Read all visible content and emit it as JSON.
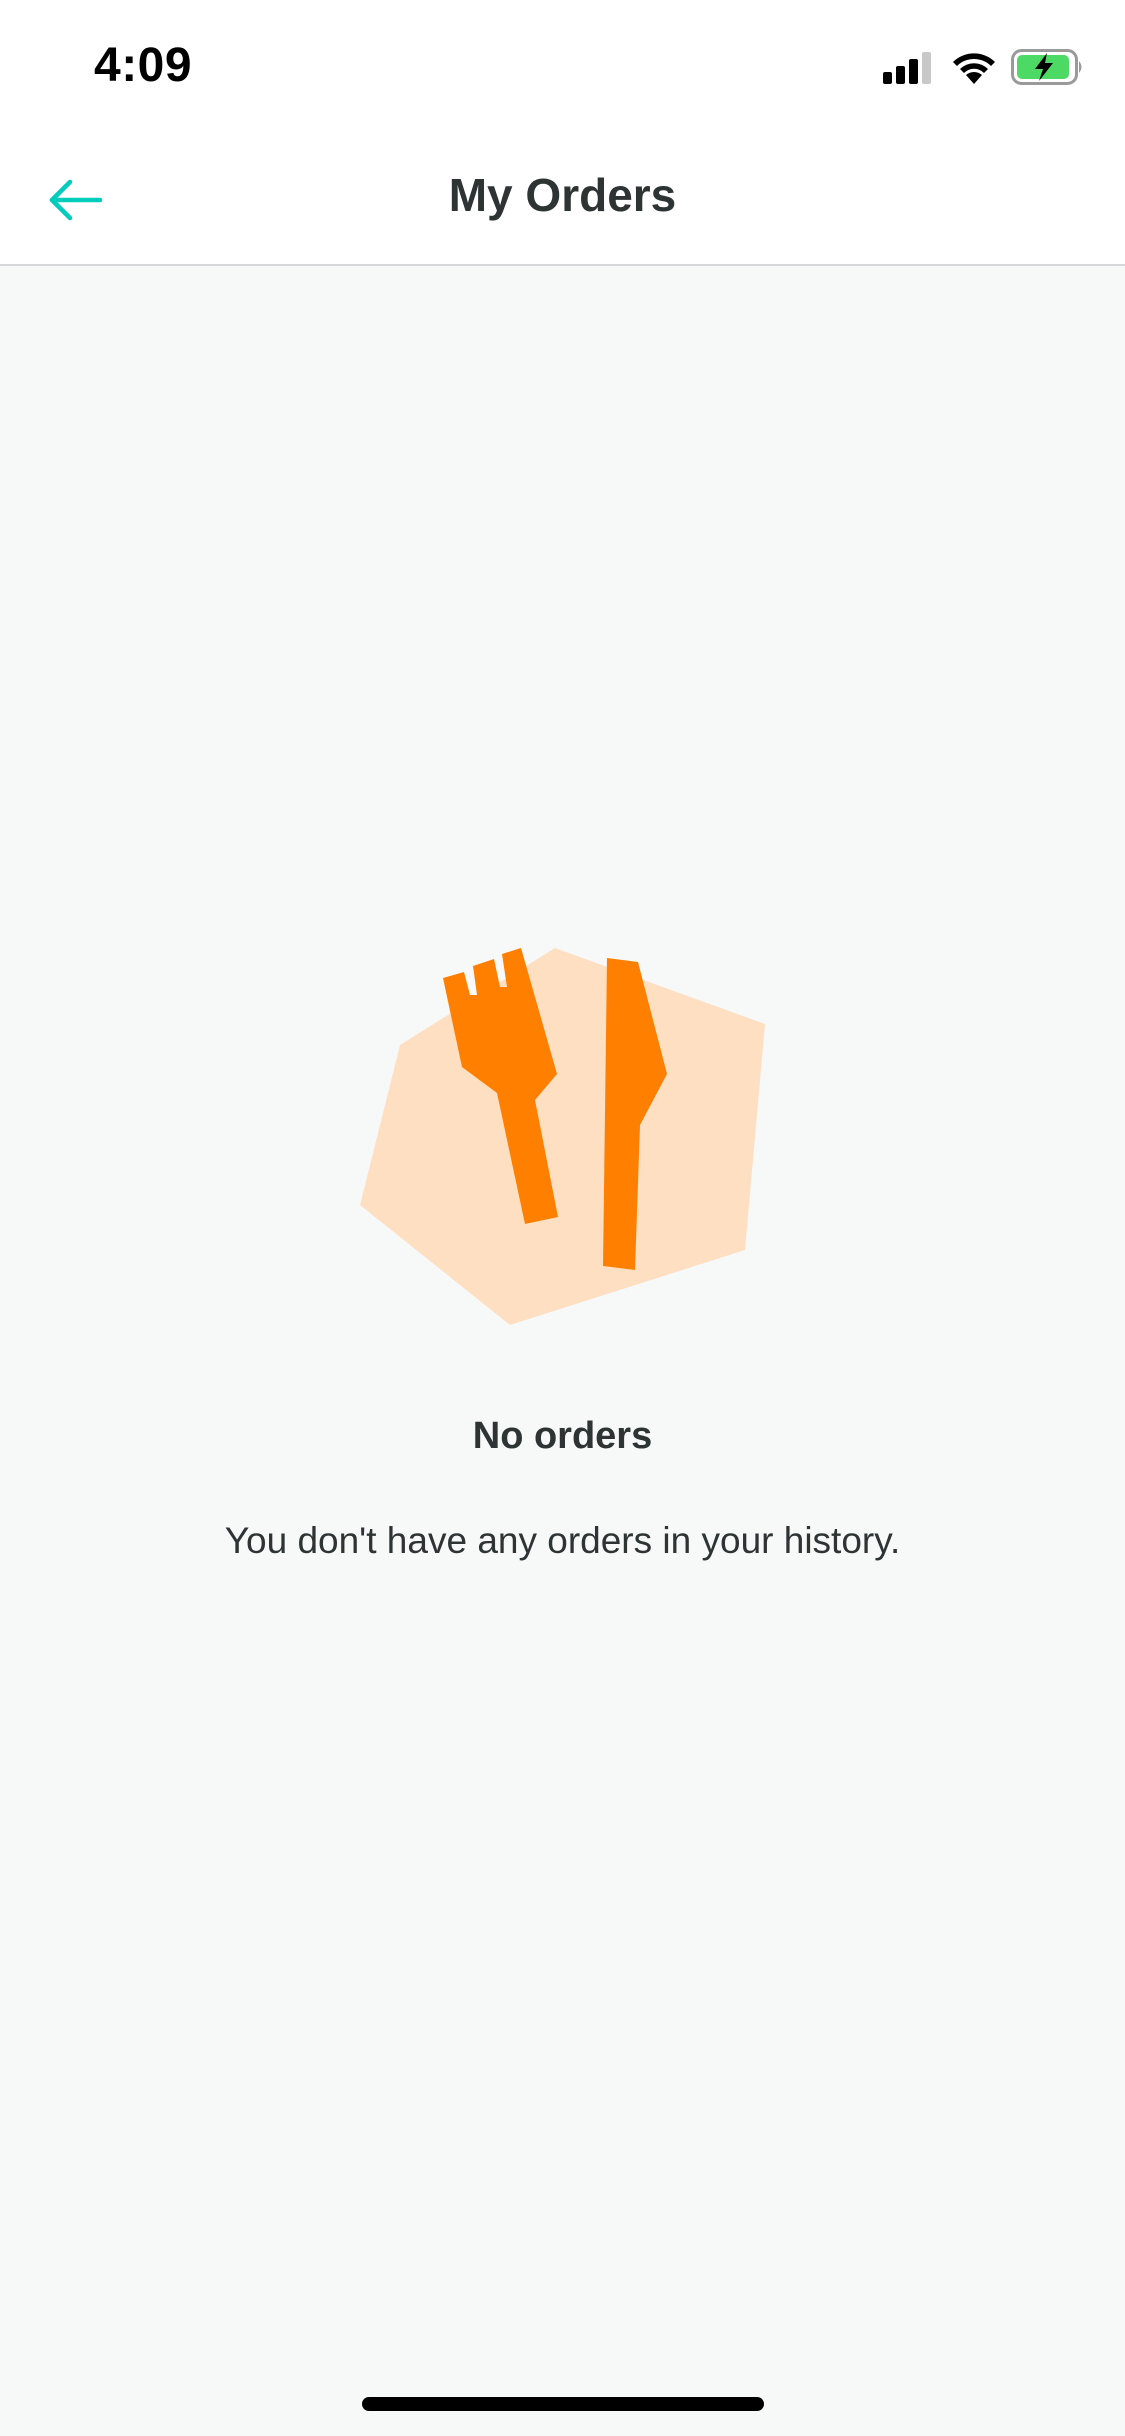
{
  "status_bar": {
    "time": "4:09",
    "icons": [
      "cellular-signal-icon",
      "wifi-icon",
      "battery-charging-icon"
    ]
  },
  "nav": {
    "back_icon": "arrow-left-icon",
    "title": "My Orders"
  },
  "empty_state": {
    "illustration": "fork-knife-icon",
    "title": "No orders",
    "message": "You don't have any orders in your history."
  },
  "colors": {
    "accent_teal": "#00ccbc",
    "orange": "#ff8000",
    "peach": "#ffdfc2",
    "text_dark": "#2e3333",
    "background": "#f7f8f8"
  }
}
